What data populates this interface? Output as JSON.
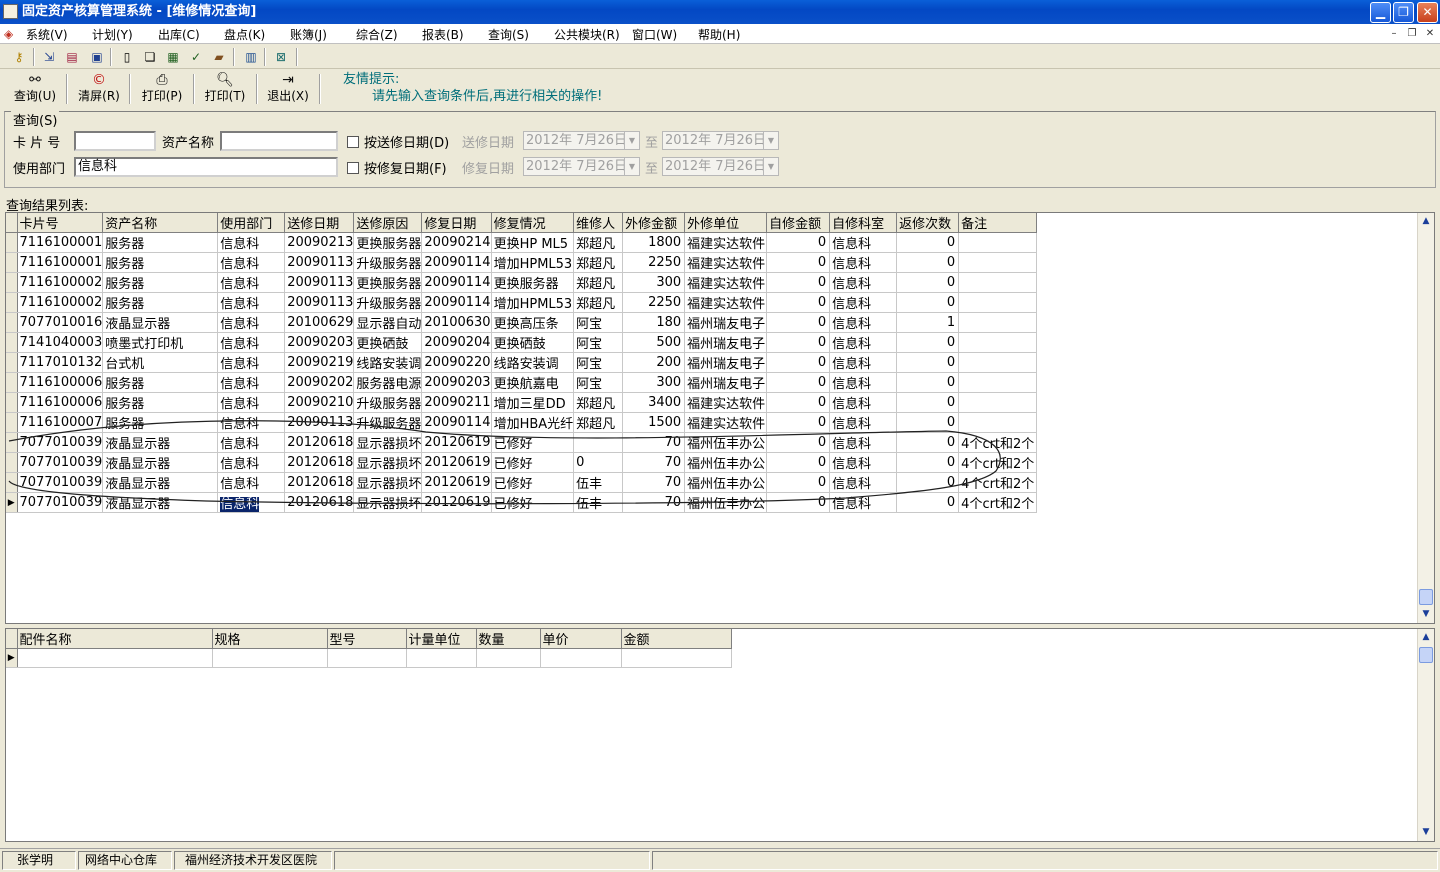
{
  "window": {
    "title": "固定资产核算管理系统 - [维修情况查询]"
  },
  "menu": [
    "系统(V)",
    "计划(Y)",
    "出库(C)",
    "盘点(K)",
    "账簿(J)",
    "综合(Z)",
    "报表(B)",
    "查询(S)",
    "公共模块(R)",
    "窗口(W)",
    "帮助(H)"
  ],
  "toolbar": {
    "query": "查询(U)",
    "clear": "清屏(R)",
    "print1": "打印(P)",
    "print2": "打印(T)",
    "exit": "退出(X)"
  },
  "hint": {
    "title": "友情提示:",
    "text": "请先输入查询条件后,再进行相关的操作!"
  },
  "query": {
    "group_label": "查询(S)",
    "card_label": "卡 片 号",
    "card_value": "",
    "asset_label": "资产名称",
    "asset_value": "",
    "dept_label": "使用部门",
    "dept_value": "信息科",
    "send_check": "按送修日期(D)",
    "send_date_label": "送修日期",
    "send_from": "2012年 7月26日",
    "to1": "至",
    "send_to": "2012年 7月26日",
    "repair_check": "按修复日期(F)",
    "repair_date_label": "修复日期",
    "repair_from": "2012年 7月26日",
    "to2": "至",
    "repair_to": "2012年 7月26日"
  },
  "results": {
    "caption": "查询结果列表:",
    "columns": [
      "卡片号",
      "资产名称",
      "使用部门",
      "送修日期",
      "送修原因",
      "修复日期",
      "修复情况",
      "维修人",
      "外修金额",
      "外修单位",
      "自修金额",
      "自修科室",
      "返修次数",
      "备注"
    ],
    "rows": [
      [
        "7116100001",
        "服务器",
        "信息科",
        "20090213",
        "更换服务器",
        "20090214",
        "更换HP ML5",
        "郑超凡",
        "1800",
        "福建实达软件",
        "0",
        "信息科",
        "0",
        ""
      ],
      [
        "7116100001",
        "服务器",
        "信息科",
        "20090113",
        "升级服务器",
        "20090114",
        "增加HPML53",
        "郑超凡",
        "2250",
        "福建实达软件",
        "0",
        "信息科",
        "0",
        ""
      ],
      [
        "7116100002",
        "服务器",
        "信息科",
        "20090113",
        "更换服务器",
        "20090114",
        "更换服务器",
        "郑超凡",
        "300",
        "福建实达软件",
        "0",
        "信息科",
        "0",
        ""
      ],
      [
        "7116100002",
        "服务器",
        "信息科",
        "20090113",
        "升级服务器",
        "20090114",
        "增加HPML53",
        "郑超凡",
        "2250",
        "福建实达软件",
        "0",
        "信息科",
        "0",
        ""
      ],
      [
        "7077010016",
        "液晶显示器",
        "信息科",
        "20100629",
        "显示器自动",
        "20100630",
        "更换高压条",
        "阿宝",
        "180",
        "福州瑞友电子",
        "0",
        "信息科",
        "1",
        ""
      ],
      [
        "7141040003",
        "喷墨式打印机",
        "信息科",
        "20090203",
        "更换硒鼓",
        "20090204",
        "更换硒鼓",
        "阿宝",
        "500",
        "福州瑞友电子",
        "0",
        "信息科",
        "0",
        ""
      ],
      [
        "7117010132",
        "台式机",
        "信息科",
        "20090219",
        "线路安装调",
        "20090220",
        "线路安装调",
        "阿宝",
        "200",
        "福州瑞友电子",
        "0",
        "信息科",
        "0",
        ""
      ],
      [
        "7116100006",
        "服务器",
        "信息科",
        "20090202",
        "服务器电源",
        "20090203",
        "更换航嘉电",
        "阿宝",
        "300",
        "福州瑞友电子",
        "0",
        "信息科",
        "0",
        ""
      ],
      [
        "7116100006",
        "服务器",
        "信息科",
        "20090210",
        "升级服务器",
        "20090211",
        "增加三星DD",
        "郑超凡",
        "3400",
        "福建实达软件",
        "0",
        "信息科",
        "0",
        ""
      ],
      [
        "7116100007",
        "服务器",
        "信息科",
        "20090113",
        "升级服务器",
        "20090114",
        "增加HBA光纤",
        "郑超凡",
        "1500",
        "福建实达软件",
        "0",
        "信息科",
        "0",
        ""
      ],
      [
        "7077010039",
        "液晶显示器",
        "信息科",
        "20120618",
        "显示器损坏",
        "20120619",
        "已修好",
        "",
        "70",
        "福州伍丰办公",
        "0",
        "信息科",
        "0",
        "4个crt和2个"
      ],
      [
        "7077010039",
        "液晶显示器",
        "信息科",
        "20120618",
        "显示器损坏",
        "20120619",
        "已修好",
        "0",
        "70",
        "福州伍丰办公",
        "0",
        "信息科",
        "0",
        "4个crt和2个"
      ],
      [
        "7077010039",
        "液晶显示器",
        "信息科",
        "20120618",
        "显示器损坏",
        "20120619",
        "已修好",
        "伍丰",
        "70",
        "福州伍丰办公",
        "0",
        "信息科",
        "0",
        "4个crt和2个"
      ],
      [
        "7077010039",
        "液晶显示器",
        "信息科",
        "20120618",
        "显示器损坏",
        "20120619",
        "已修好",
        "伍丰",
        "70",
        "福州伍丰办公",
        "0",
        "信息科",
        "0",
        "4个crt和2个"
      ]
    ]
  },
  "parts": {
    "columns": [
      "配件名称",
      "规格",
      "型号",
      "计量单位",
      "数量",
      "单价",
      "金额"
    ]
  },
  "status": {
    "user": "张学明",
    "warehouse": "网络中心仓库",
    "org": "福州经济技术开发区医院"
  }
}
